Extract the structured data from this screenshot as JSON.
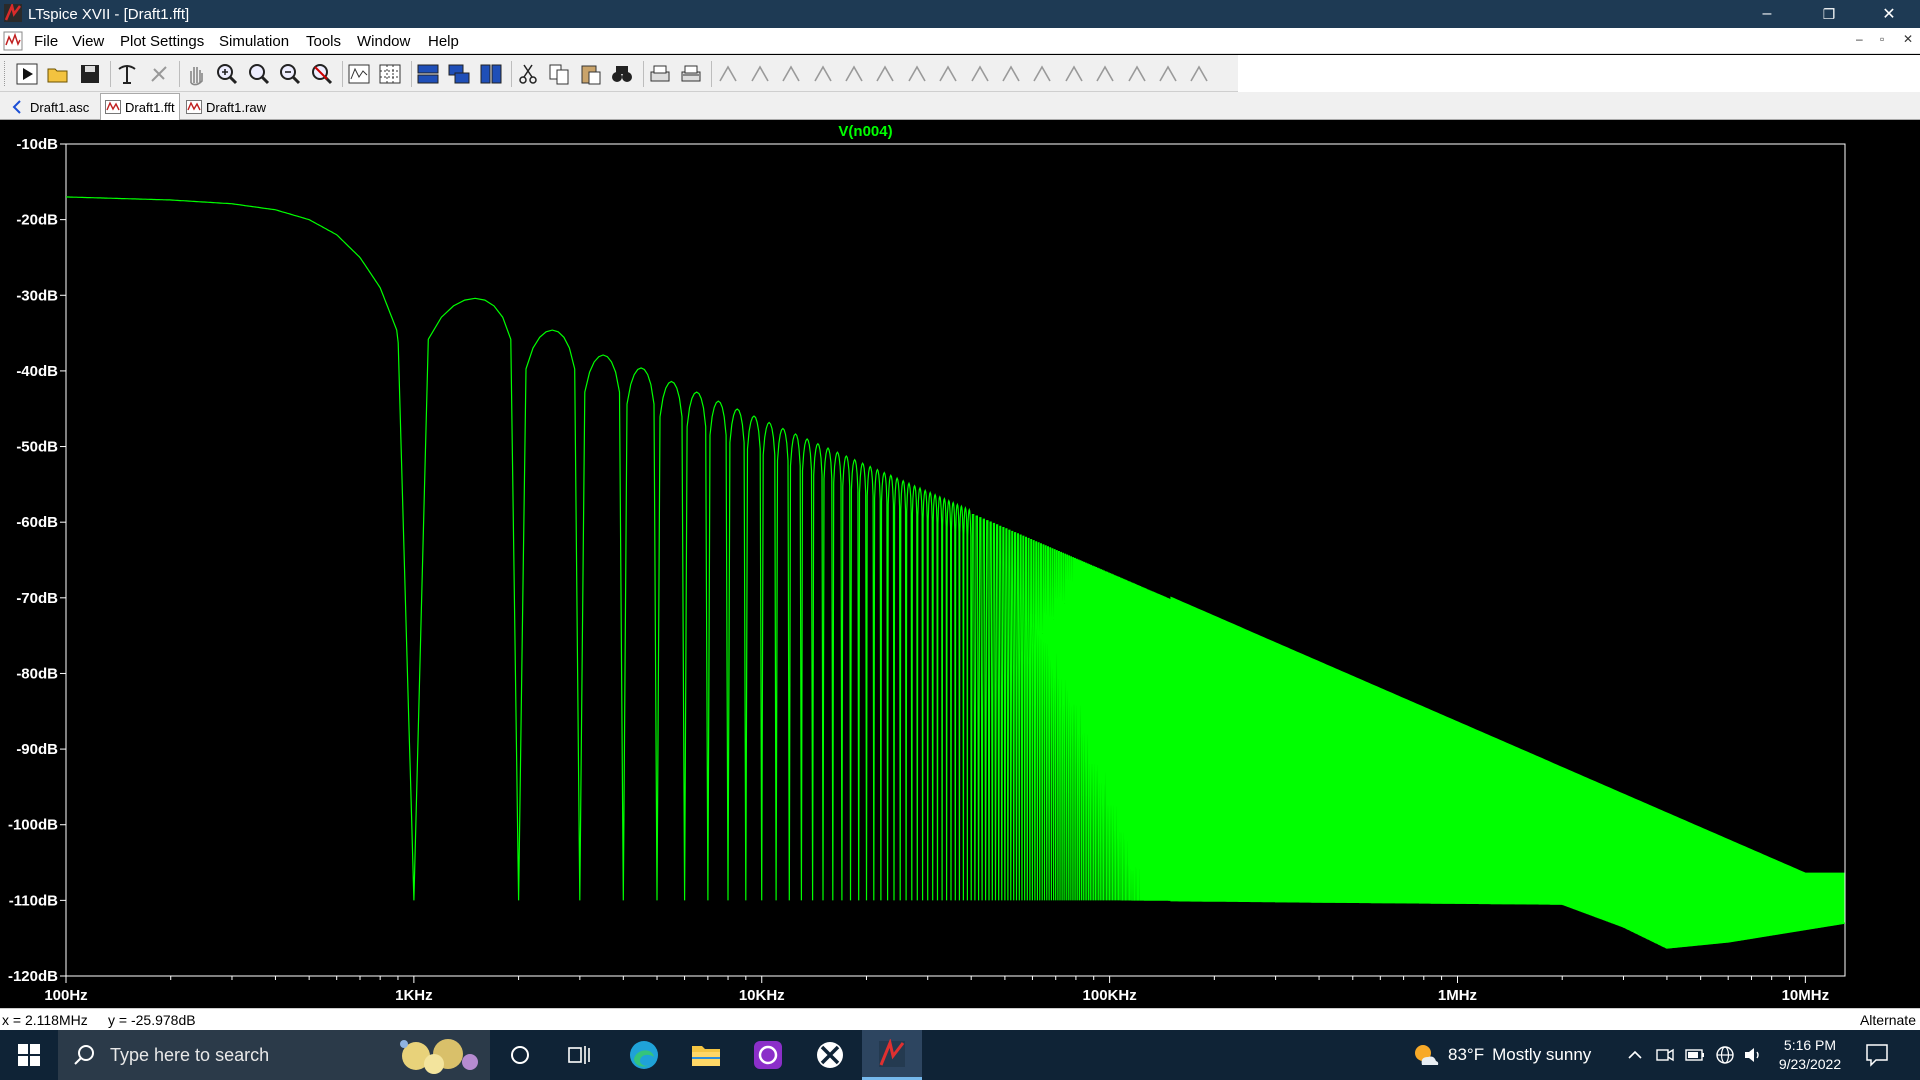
{
  "window": {
    "title": "LTspice XVII - [Draft1.fft]",
    "minimize_glyph": "–",
    "restore_glyph": "❐",
    "close_glyph": "✕"
  },
  "menu": {
    "items": [
      "File",
      "View",
      "Plot Settings",
      "Simulation",
      "Tools",
      "Window",
      "Help"
    ],
    "mdi_minimize": "–",
    "mdi_restore": "▫",
    "mdi_close": "✕"
  },
  "toolbar": {
    "buttons": [
      "run-icon",
      "open-icon",
      "save-icon",
      "control-panel-icon",
      "halt-icon",
      "pan-icon",
      "zoom-in-icon",
      "zoom-area-icon",
      "zoom-out-icon",
      "zoom-fit-icon",
      "autorange-icon",
      "grid-icon",
      "tile-horizontal-icon",
      "cascade-icon",
      "tile-vertical-icon",
      "cut-icon",
      "copy-icon",
      "paste-icon",
      "find-icon",
      "print-icon",
      "print-preview-icon",
      "wire-icon",
      "ground-icon",
      "label-icon",
      "resistor-icon",
      "capacitor-icon",
      "inductor-icon",
      "diode-icon",
      "component-icon",
      "move-icon",
      "drag-icon",
      "undo-icon",
      "redo-icon",
      "rotate-icon",
      "mirror-icon",
      "text-icon",
      "spice-directive-icon"
    ]
  },
  "tabs": [
    {
      "label": "Draft1.asc",
      "icon": "schematic-icon",
      "active": false
    },
    {
      "label": "Draft1.fft",
      "icon": "waveform-icon",
      "active": true
    },
    {
      "label": "Draft1.raw",
      "icon": "waveform-icon",
      "active": false
    }
  ],
  "chart_data": {
    "type": "line",
    "title": "V(n004)",
    "xscale": "log",
    "xlim": [
      100,
      13000000
    ],
    "ylim": [
      -120,
      -10
    ],
    "x_ticks": [
      "100Hz",
      "1KHz",
      "10KHz",
      "100KHz",
      "1MHz",
      "10MHz"
    ],
    "y_ticks": [
      "-10dB",
      "-20dB",
      "-30dB",
      "-40dB",
      "-50dB",
      "-60dB",
      "-70dB",
      "-80dB",
      "-90dB",
      "-100dB",
      "-110dB",
      "-120dB"
    ],
    "grid": false,
    "series": [
      {
        "name": "V(n004)",
        "color": "#00ff00",
        "description_points": {
          "x": [
            100,
            200,
            300,
            400,
            500,
            600,
            700,
            800,
            900,
            1000,
            1500,
            2000,
            2500,
            3000,
            3500,
            4000,
            5000,
            6000,
            8000,
            10000
          ],
          "envelope_db": [
            -17,
            -17.4,
            -17.9,
            -18.7,
            -20,
            -22,
            -25,
            -29,
            -35,
            -110,
            -30.4,
            -110,
            -34.6,
            -110,
            -37.9,
            -110,
            -40,
            -41.6,
            -44,
            -46
          ]
        },
        "lobe_peaks_db": {
          "x": [
            1500,
            2500,
            3500,
            4500,
            5500,
            6500,
            10000,
            100000,
            1000000,
            10000000
          ],
          "y": [
            -30.4,
            -34.6,
            -37.9,
            -39.6,
            -41.4,
            -42.8,
            -46.4,
            -66.4,
            -86.4,
            -106.4
          ]
        },
        "noise_floor_db": {
          "x": [
            1000,
            100000,
            2000000,
            3000000,
            4000000,
            6000000,
            13000000
          ],
          "y": [
            -110,
            -110,
            -110.5,
            -113.5,
            -116.3,
            -115.5,
            -113
          ]
        }
      }
    ]
  },
  "status": {
    "cursor_x": "x = 2.118MHz",
    "cursor_y": "y = -25.978dB",
    "mode": "Alternate"
  },
  "taskbar": {
    "search_placeholder": "Type here to search",
    "weather_temp": "83°F",
    "weather_text": "Mostly sunny",
    "time": "5:16 PM",
    "date": "9/23/2022",
    "accent": "#76b9ed"
  }
}
